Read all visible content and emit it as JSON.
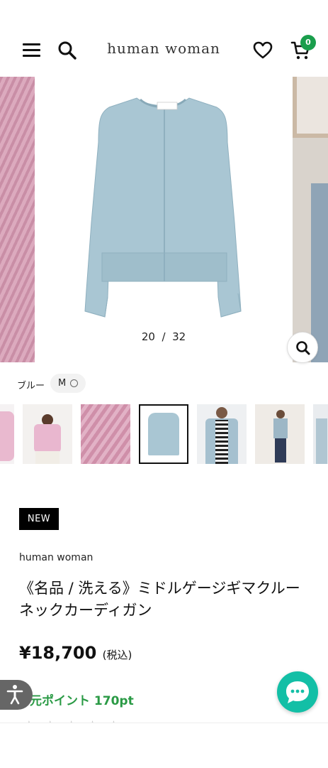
{
  "header": {
    "logo": "human woman",
    "cart_count": "0",
    "icons": [
      "menu-icon",
      "search-icon",
      "heart-icon",
      "cart-icon"
    ]
  },
  "carousel": {
    "current": "20",
    "separator": "/",
    "total": "32"
  },
  "variant": {
    "color": "ブルー",
    "size": "M"
  },
  "product": {
    "badge": "NEW",
    "brand": "human woman",
    "title": "《名品 / 洗える》ミドルゲージギマクルーネックカーディガン",
    "price": "¥18,700",
    "tax": "(税込)",
    "points": "元ポイント 170pt"
  },
  "colors": {
    "accent_green": "#1a9e4c",
    "chat": "#13bfa6",
    "sweater_blue": "#a9c6d3"
  }
}
